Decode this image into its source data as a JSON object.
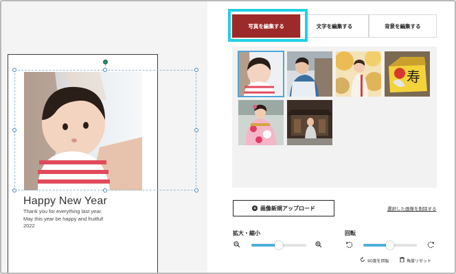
{
  "card": {
    "title": "Happy New Year",
    "message_line1": "Thank you for everything last year.",
    "message_line2": "May this year be happy and fruitful!",
    "year": "2022"
  },
  "tabs": [
    {
      "label": "写真を編集する",
      "active": true
    },
    {
      "label": "文字を編集する",
      "active": false
    },
    {
      "label": "背景を編集する",
      "active": false
    }
  ],
  "gallery": {
    "photos": [
      {
        "icon": "photo-baby-girl",
        "selected": true
      },
      {
        "icon": "photo-child-shrine",
        "selected": false
      },
      {
        "icon": "photo-child-autumn",
        "selected": false
      },
      {
        "icon": "photo-ema-tiger",
        "selected": false
      },
      {
        "icon": "photo-girl-kimono",
        "selected": false
      },
      {
        "icon": "photo-family-shrine",
        "selected": false
      }
    ]
  },
  "upload_button": "画像新規アップロード",
  "delete_link": "選択した画像を削除する",
  "zoom": {
    "label": "拡大・縮小",
    "value": 0.5
  },
  "rotate": {
    "label": "回転",
    "value": 0.5
  },
  "rotate90_label": "90度を回転",
  "reset_angle_label": "角度リセット",
  "colors": {
    "accent": "#9c2a2a",
    "highlight": "#1fd0e6",
    "slider": "#4ab0dc"
  }
}
